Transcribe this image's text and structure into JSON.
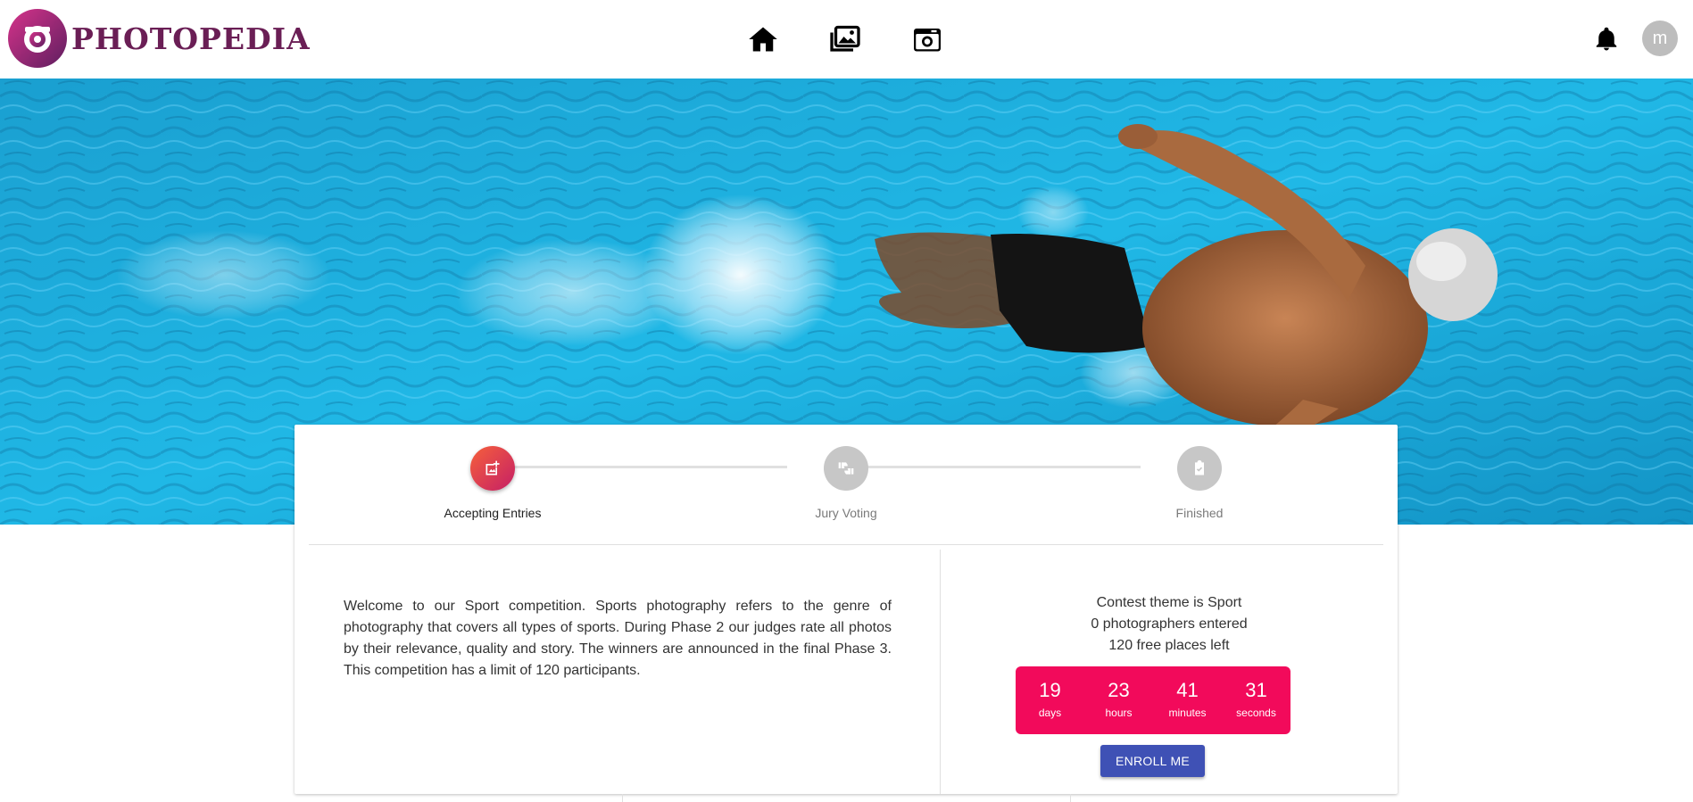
{
  "header": {
    "brand": "PHOTOPEDIA",
    "nav": [
      {
        "name": "home-icon"
      },
      {
        "name": "gallery-icon"
      },
      {
        "name": "camera-icon"
      }
    ],
    "notifications_icon": "bell-icon",
    "avatar_initial": "m"
  },
  "hero": {
    "image": "swimmer-in-pool-photo"
  },
  "stepper": {
    "steps": [
      {
        "label": "Accepting Entries",
        "icon": "add-photo-icon",
        "active": true
      },
      {
        "label": "Jury Voting",
        "icon": "thumbs-icon",
        "active": false
      },
      {
        "label": "Finished",
        "icon": "clipboard-check-icon",
        "active": false
      }
    ]
  },
  "contest": {
    "description": "Welcome to our Sport competition. Sports photography refers to the genre of photography that covers all types of sports. During Phase 2 our judges rate all photos by their relevance, quality and story. The winners are announced in the final Phase 3. This competition has a limit of 120 participants.",
    "theme_line": "Contest theme is Sport",
    "entered_line": "0 photographers entered",
    "places_line": "120 free places left",
    "countdown": {
      "days": "19",
      "days_label": "days",
      "hours": "23",
      "hours_label": "hours",
      "minutes": "41",
      "minutes_label": "minutes",
      "seconds": "31",
      "seconds_label": "seconds"
    },
    "enroll_label": "ENROLL ME"
  },
  "colors": {
    "brand": "#6a1e55",
    "countdown_bg": "#f20a5b",
    "enroll_bg": "#3f51b5",
    "pool_water": "#1fb3e0"
  }
}
